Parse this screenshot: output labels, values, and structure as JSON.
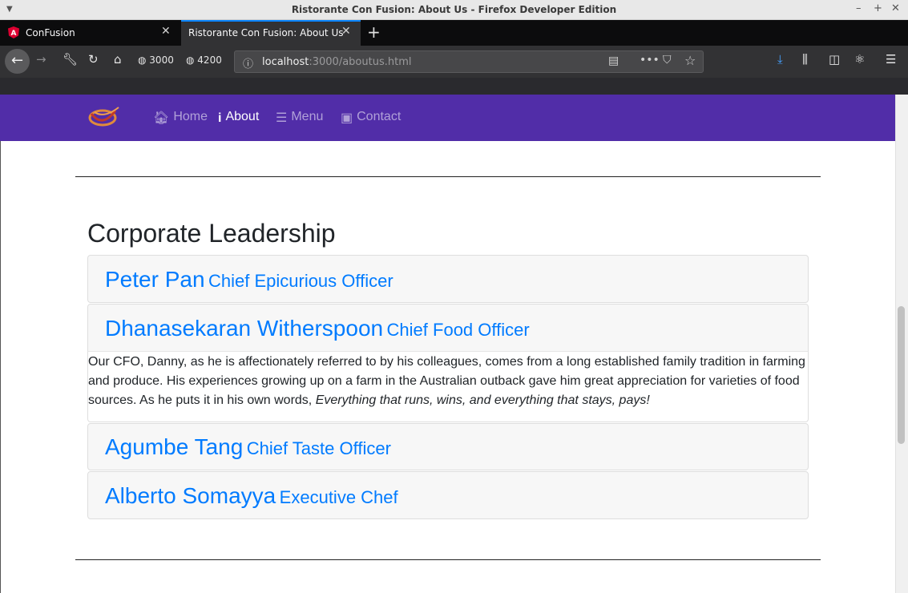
{
  "window": {
    "title": "Ristorante Con Fusion: About Us - Firefox Developer Edition"
  },
  "tabs": [
    {
      "label": "ConFusion"
    },
    {
      "label": "Ristorante Con Fusion: About Us"
    }
  ],
  "toolbar": {
    "bookmark_3000": "3000",
    "bookmark_4200": "4200",
    "url_host": "localhost",
    "url_rest": ":3000/aboutus.html"
  },
  "nav": {
    "home": "Home",
    "about": "About",
    "menu": "Menu",
    "contact": "Contact"
  },
  "main": {
    "heading": "Corporate Leadership",
    "leaders": [
      {
        "name": "Peter Pan",
        "role": "Chief Epicurious Officer"
      },
      {
        "name": "Dhanasekaran Witherspoon",
        "role": "Chief Food Officer",
        "description": "Our CFO, Danny, as he is affectionately referred to by his colleagues, comes from a long established family tradition in farming and produce. His experiences growing up on a farm in the Australian outback gave him great appreciation for varieties of food sources. As he puts it in his own words, ",
        "quote": "Everything that runs, wins, and everything that stays, pays!"
      },
      {
        "name": "Agumbe Tang",
        "role": "Chief Taste Officer"
      },
      {
        "name": "Alberto Somayya",
        "role": "Executive Chef"
      }
    ]
  },
  "colors": {
    "navbar": "#512da8",
    "link": "#007bff",
    "tab_accent": "#0a84ff"
  }
}
